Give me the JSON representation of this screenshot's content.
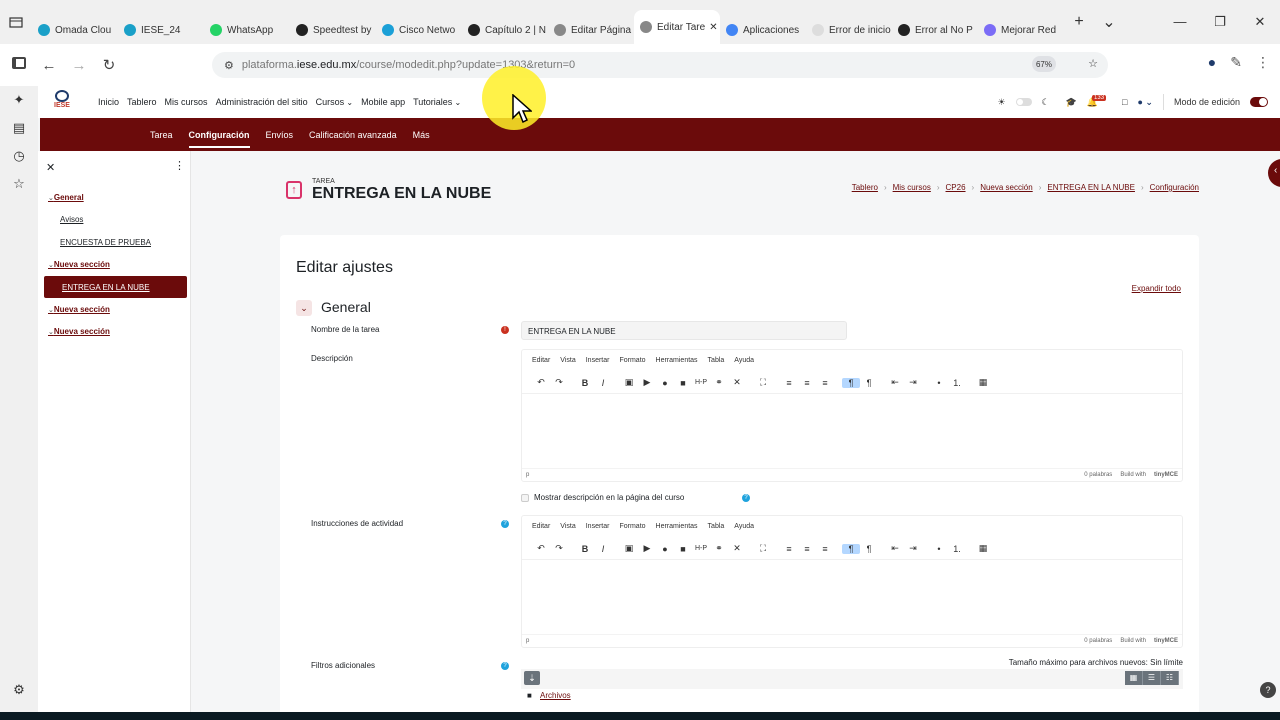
{
  "browser": {
    "tabs": [
      {
        "label": "Omada Clou",
        "color": "#1aa0c8"
      },
      {
        "label": "IESE_24",
        "color": "#1aa0c8"
      },
      {
        "label": "WhatsApp",
        "color": "#25d366"
      },
      {
        "label": "Speedtest by",
        "color": "#222222"
      },
      {
        "label": "Cisco Netwo",
        "color": "#1ba0d7"
      },
      {
        "label": "Capítulo 2 | N",
        "color": "#222222"
      },
      {
        "label": "Editar Página",
        "color": "#888888"
      },
      {
        "label": "Editar Tare",
        "color": "#888888",
        "active": true
      },
      {
        "label": "Aplicaciones",
        "color": "#4285f4"
      },
      {
        "label": "Error de inicio de",
        "color": "#dddddd"
      },
      {
        "label": "Error al No P",
        "color": "#222222"
      },
      {
        "label": "Mejorar Red",
        "color": "#7b6cf6"
      }
    ],
    "url_prefix": "plataforma.",
    "url_host": "iese.edu.mx",
    "url_path": "/course/modedit.php?update=1303&return=0",
    "zoom": "67%"
  },
  "site": {
    "logo_text": "IESE",
    "nav": [
      "Inicio",
      "Tablero",
      "Mis cursos",
      "Administración del sitio",
      "Cursos",
      "Mobile app",
      "Tutoriales"
    ],
    "notif_count": "133",
    "edit_mode_label": "Modo de edición",
    "secnav": [
      "Tarea",
      "Configuración",
      "Envíos",
      "Calificación avanzada",
      "Más"
    ],
    "secnav_active": "Configuración"
  },
  "course_index": {
    "items": [
      {
        "label": "General",
        "type": "section"
      },
      {
        "label": "Avisos",
        "type": "activity"
      },
      {
        "label": "ENCUESTA DE PRUEBA",
        "type": "activity"
      },
      {
        "label": "Nueva sección",
        "type": "section"
      },
      {
        "label": "ENTREGA EN LA NUBE",
        "type": "activity",
        "active": true
      },
      {
        "label": "Nueva sección",
        "type": "section"
      },
      {
        "label": "Nueva sección",
        "type": "section"
      }
    ]
  },
  "header": {
    "kind": "TAREA",
    "title": "ENTREGA EN LA NUBE",
    "breadcrumbs": [
      "Tablero",
      "Mis cursos",
      "CP26",
      "Nueva sección",
      "ENTREGA EN LA NUBE",
      "Configuración"
    ]
  },
  "form": {
    "heading": "Editar ajustes",
    "expand_all": "Expandir todo",
    "section_general": "General",
    "name_label": "Nombre de la tarea",
    "name_value": "ENTREGA EN LA NUBE",
    "desc_label": "Descripción",
    "show_desc_label": "Mostrar descripción en la página del curso",
    "instr_label": "Instrucciones de actividad",
    "files_label": "Filtros adicionales",
    "max_size": "Tamaño máximo para archivos nuevos: Sin límite",
    "files_folder": "Archivos"
  },
  "editor": {
    "menu": [
      "Editar",
      "Vista",
      "Insertar",
      "Formato",
      "Herramientas",
      "Tabla",
      "Ayuda"
    ],
    "status_path": "p",
    "word_count": "0 palabras",
    "built_with": "Build with",
    "brand": "tinyMCE"
  },
  "colors": {
    "brand": "#6b0b0b",
    "help": "#1fa3dd",
    "required": "#ca3120"
  }
}
